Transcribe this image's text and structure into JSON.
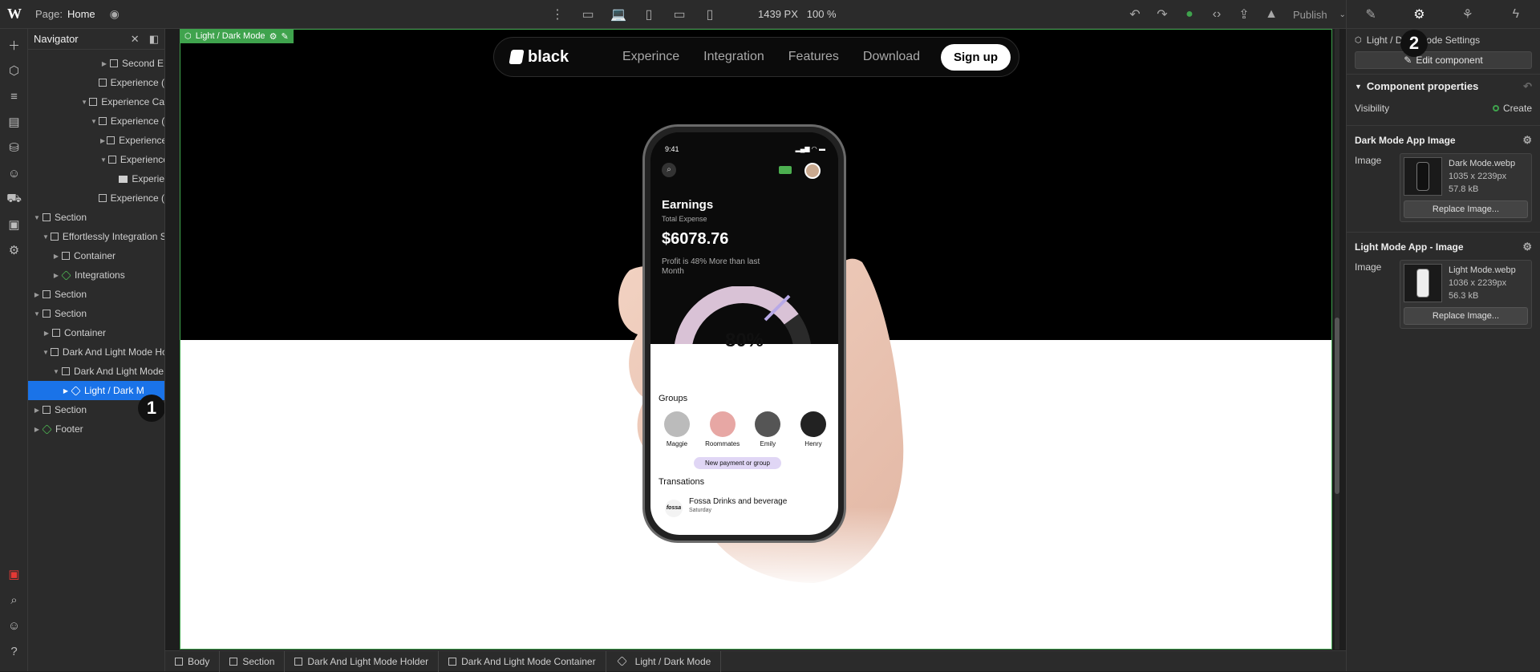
{
  "topbar": {
    "logo": "W",
    "page_label": "Page:",
    "page_value": "Home",
    "width_value": "1439",
    "width_unit": "PX",
    "zoom": "100 %",
    "publish_label": "Publish"
  },
  "navigator": {
    "title": "Navigator",
    "rows": [
      {
        "label": "Second E",
        "indent": 7,
        "caret": "right",
        "icon": "box"
      },
      {
        "label": "Experience (",
        "indent": 6,
        "caret": "",
        "icon": "box"
      },
      {
        "label": "Experience Ca",
        "indent": 5,
        "caret": "down",
        "icon": "box"
      },
      {
        "label": "Experience (",
        "indent": 6,
        "caret": "down",
        "icon": "box"
      },
      {
        "label": "Experience",
        "indent": 7,
        "caret": "right",
        "icon": "box"
      },
      {
        "label": "Experience",
        "indent": 7,
        "caret": "down",
        "icon": "box"
      },
      {
        "label": "Experie",
        "indent": 8,
        "caret": "",
        "icon": "image"
      },
      {
        "label": "Experience (",
        "indent": 6,
        "caret": "",
        "icon": "box"
      },
      {
        "label": "Section",
        "indent": 0,
        "caret": "down",
        "icon": "box"
      },
      {
        "label": "Effortlessly Integration S",
        "indent": 1,
        "caret": "down",
        "icon": "box"
      },
      {
        "label": "Container",
        "indent": 2,
        "caret": "right",
        "icon": "box"
      },
      {
        "label": "Integrations",
        "indent": 2,
        "caret": "right",
        "icon": "component"
      },
      {
        "label": "Section",
        "indent": 0,
        "caret": "right",
        "icon": "box"
      },
      {
        "label": "Section",
        "indent": 0,
        "caret": "down",
        "icon": "box"
      },
      {
        "label": "Container",
        "indent": 1,
        "caret": "right",
        "icon": "box"
      },
      {
        "label": "Dark And Light Mode Ho",
        "indent": 1,
        "caret": "down",
        "icon": "box"
      },
      {
        "label": "Dark And Light Mode",
        "indent": 2,
        "caret": "down",
        "icon": "box"
      },
      {
        "label": "Light / Dark M",
        "indent": 3,
        "caret": "right",
        "icon": "component",
        "selected": true
      },
      {
        "label": "Section",
        "indent": 0,
        "caret": "right",
        "icon": "box"
      },
      {
        "label": "Footer",
        "indent": 0,
        "caret": "right",
        "icon": "component"
      }
    ]
  },
  "annotations": {
    "one": "1",
    "two": "2"
  },
  "canvas": {
    "selection_label": "Light / Dark Mode",
    "site": {
      "brand": "black",
      "links": [
        "Experince",
        "Integration",
        "Features",
        "Download"
      ],
      "cta": "Sign up"
    },
    "phone": {
      "time": "9:41",
      "earnings_title": "Earnings",
      "earnings_sub": "Total Expense",
      "amount": "$6078.76",
      "profit_text": "Profit is 48% More than last Month",
      "gauge_value": "80%",
      "gauge_fraction": 0.8,
      "groups_title": "Groups",
      "groups": [
        "Maggie",
        "Roommates",
        "Emily",
        "Henry"
      ],
      "new_payment": "New payment or group",
      "transactions_title": "Transations",
      "tx_name": "Fossa Drinks and beverage",
      "tx_day": "Saturday",
      "tx_logo": "fossa"
    }
  },
  "right_panel": {
    "title": "Light / Dark Mode Settings",
    "edit_button": "Edit component",
    "section_title": "Component properties",
    "visibility_label": "Visibility",
    "visibility_action": "Create",
    "props": [
      {
        "title": "Dark Mode App Image",
        "label": "Image",
        "file": "Dark Mode.webp",
        "dims": "1035 x 2239px",
        "size": "57.8 kB",
        "button": "Replace Image...",
        "theme": "dark"
      },
      {
        "title": "Light Mode App - Image",
        "label": "Image",
        "file": "Light Mode.webp",
        "dims": "1036 x 2239px",
        "size": "56.3 kB",
        "button": "Replace Image...",
        "theme": "light"
      }
    ]
  },
  "breadcrumb": [
    "Body",
    "Section",
    "Dark And Light Mode Holder",
    "Dark And Light Mode Container",
    "Light / Dark Mode"
  ]
}
